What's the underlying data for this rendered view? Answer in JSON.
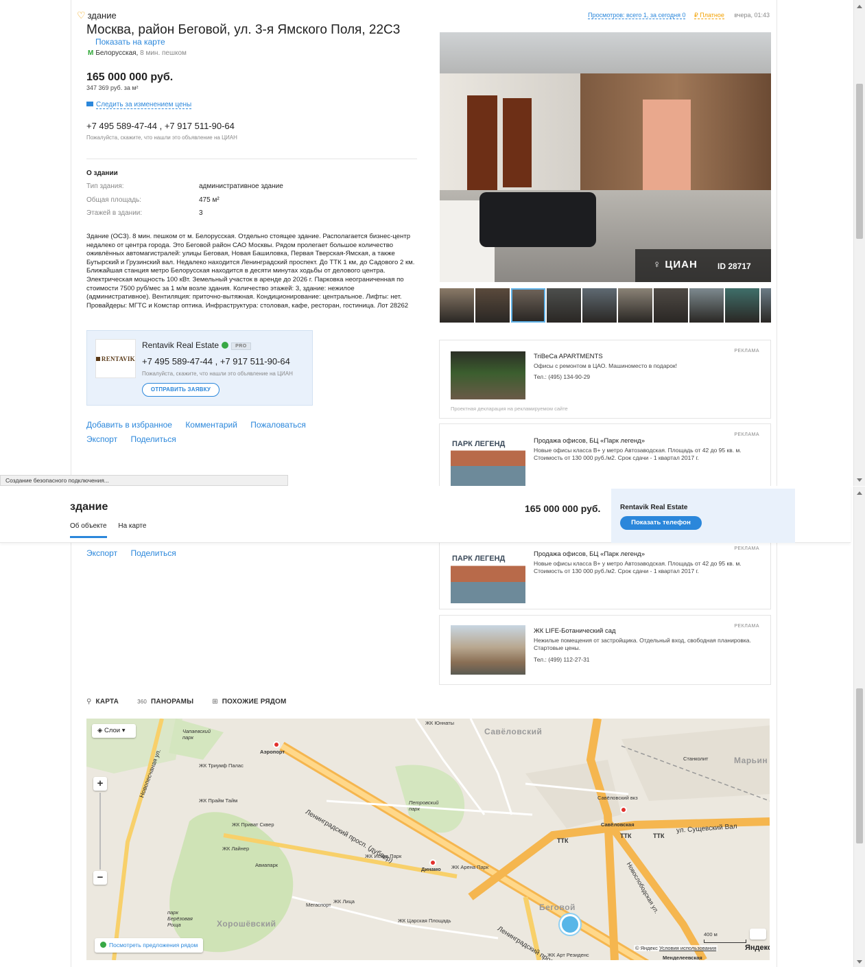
{
  "listing": {
    "type_label": "здание",
    "address": "Москва, район Беговой, ул. 3-я Ямского Поля, 22С3",
    "show_on_map": "Показать на карте",
    "metro_icon": "М",
    "metro_station": "Белорусская,",
    "metro_walk": "8 мин. пешком",
    "price": "165 000 000 руб.",
    "price_per_m2": "347 369 руб. за м²",
    "follow_price": "Следить за изменением цены",
    "phones": "+7 495 589-47-44 , +7 917 511-90-64",
    "phone_note": "Пожалуйста, скажите, что нашли это объявление на ЦИАН",
    "views": "Просмотров: всего 1, за сегодня 0",
    "paid_icon": "₽",
    "paid": "Платное",
    "published": "вчера, 01:43"
  },
  "about": {
    "heading": "О здании",
    "rows": [
      {
        "key": "Тип здания:",
        "value": "административное здание"
      },
      {
        "key": "Общая площадь:",
        "value": "475 м²"
      },
      {
        "key": "Этажей в здании:",
        "value": "3"
      }
    ],
    "description": "Здание (ОСЗ). 8 мин. пешком от м. Белорусская. Отдельно стоящее здание. Располагается бизнес-центр недалеко от центра города. Это Беговой район САО Москвы. Рядом пролегает большое количество оживлённых автомагистралей: улицы Беговая, Новая Башиловка, Первая Тверская-Ямская, а также Бутырский и Грузинский вал. Недалеко находится Ленинградский проспект. До ТТК 1 км, до Садового 2 км. Ближайшая станция метро Белорусская находится в десяти минутах ходьбы от делового центра. Электрическая мощность 100 кВт. Земельный участок в аренде до 2026 г. Парковка неограниченная по стоимости 7500 руб/мес за 1 м/м возле здания. Количество этажей: 3, здание: нежилое (административное). Вентиляция: приточно-вытяжная. Кондиционирование: центральное. Лифты: нет. Провайдеры: МГТС и Комстар оптика. Инфраструктура: столовая, кафе, ресторан, гостиница. Лот 28262"
  },
  "agent": {
    "logo_text": "RENTAVIK",
    "name": "Rentavik Real Estate",
    "pro": "PRO",
    "phones": "+7 495 589-47-44 , +7 917 511-90-64",
    "note": "Пожалуйста, скажите, что нашли это объявление на ЦИАН",
    "send_request": "ОТПРАВИТЬ ЗАЯВКУ"
  },
  "actions": {
    "favorite": "Добавить в избранное",
    "comment": "Комментарий",
    "complain": "Пожаловаться",
    "export": "Экспорт",
    "share": "Поделиться"
  },
  "photo": {
    "watermark": "ЦИАН",
    "id_label": "ID 28717",
    "thumb_colors": [
      "#8a7a68",
      "#5a4a3c",
      "#6d6258",
      "#4d4f4d",
      "#5f6a72",
      "#8a8276",
      "#4f4a45",
      "#7d8a8f",
      "#3f6f6a",
      "#6b7b86"
    ],
    "selected_thumb": 2
  },
  "ads": [
    {
      "tag": "РЕКЛАМА",
      "title": "TriBeCa APARTMENTS",
      "text": "Офисы с ремонтом в ЦАО. Машиноместо в подарок!",
      "tel": "Тел.: (495) 134-90-29",
      "foot": "Проектная декларация на рекламируемом сайте"
    },
    {
      "tag": "РЕКЛАМА",
      "logo": "ПАРК ЛЕГЕНД",
      "title": "Продажа офисов, БЦ «Парк легенд»",
      "text": "Новые офисы класса В+ у метро Автозаводская. Площадь от 42 до 95 кв. м. Стоимость от 130 000 руб./м2. Срок сдачи - 1 квартал 2017 г."
    },
    {
      "tag": "РЕКЛАМА",
      "title": "ЖК LIFE-Ботанический сад",
      "text": "Нежилые помещения от застройщика. Отдельный вход, свободная планировка. Стартовые цены.",
      "tel": "Тел.: (499) 112-27-31"
    }
  ],
  "status_bar": "Создание безопасного подключения...",
  "sticky": {
    "title": "здание",
    "tab_about": "Об объекте",
    "tab_map": "На карте",
    "price": "165 000 000 руб.",
    "agent_name": "Rentavik Real Estate",
    "show_phone": "Показать телефон"
  },
  "map_tabs": {
    "map": "КАРТА",
    "panoramas": "ПАНОРАМЫ",
    "similar": "ПОХОЖИЕ РЯДОМ",
    "panorama_badge": "360"
  },
  "map": {
    "layers": "Слои",
    "nearby": "Посмотреть предложения рядом",
    "scale": "400 м",
    "copyright": "© Яндекс",
    "terms": "Условия использования",
    "yandex": "Яндекс",
    "zoom_plus": "+",
    "zoom_minus": "−",
    "labels": {
      "savelovsky": "Савёловский",
      "savelovsky_station": "Савёловская",
      "savelovsky_vkz": "Савёловский вкз",
      "aeroport": "Аэропорт",
      "dinamo": "Динамо",
      "begovoy": "Беговой",
      "khoroshevsky": "Хорошёвский",
      "maryino": "Марьин",
      "leningradsky": "Ленинградский просп. (дублер)",
      "leningradsky2": "Ленинградский прос",
      "sushchevsky": "ул. Сущевский Вал",
      "novoslobodskaya": "Новослободская ул.",
      "ttk1": "ТТК",
      "ttk2": "ТТК",
      "ttk3": "ТТК",
      "triumph": "ЖК Триумф Палас",
      "prime": "ЖК Прайм Тайм",
      "privat": "ЖК Приват Сквер",
      "lainer": "ЖК Лайнер",
      "iskra": "ЖК Искра Парк",
      "arena": "ЖК Арена Парк",
      "litsa": "ЖК Лица",
      "tsarskaya": "ЖК Царская Площадь",
      "art": "ЖК Арт Резиденс",
      "yunaty": "ЖК Юннаты",
      "aviapark": "Авиапарк",
      "megasport": "Мегаспорт",
      "petrovsky": "Петровский парк",
      "chapaevsky": "Чапаевский парк",
      "berezovaya": "парк Берёзовая Роща",
      "novopeschanaya": "Новопесчаная ул.",
      "stankolit": "Станколит",
      "mendeleevskaya": "Менделеевская"
    }
  }
}
